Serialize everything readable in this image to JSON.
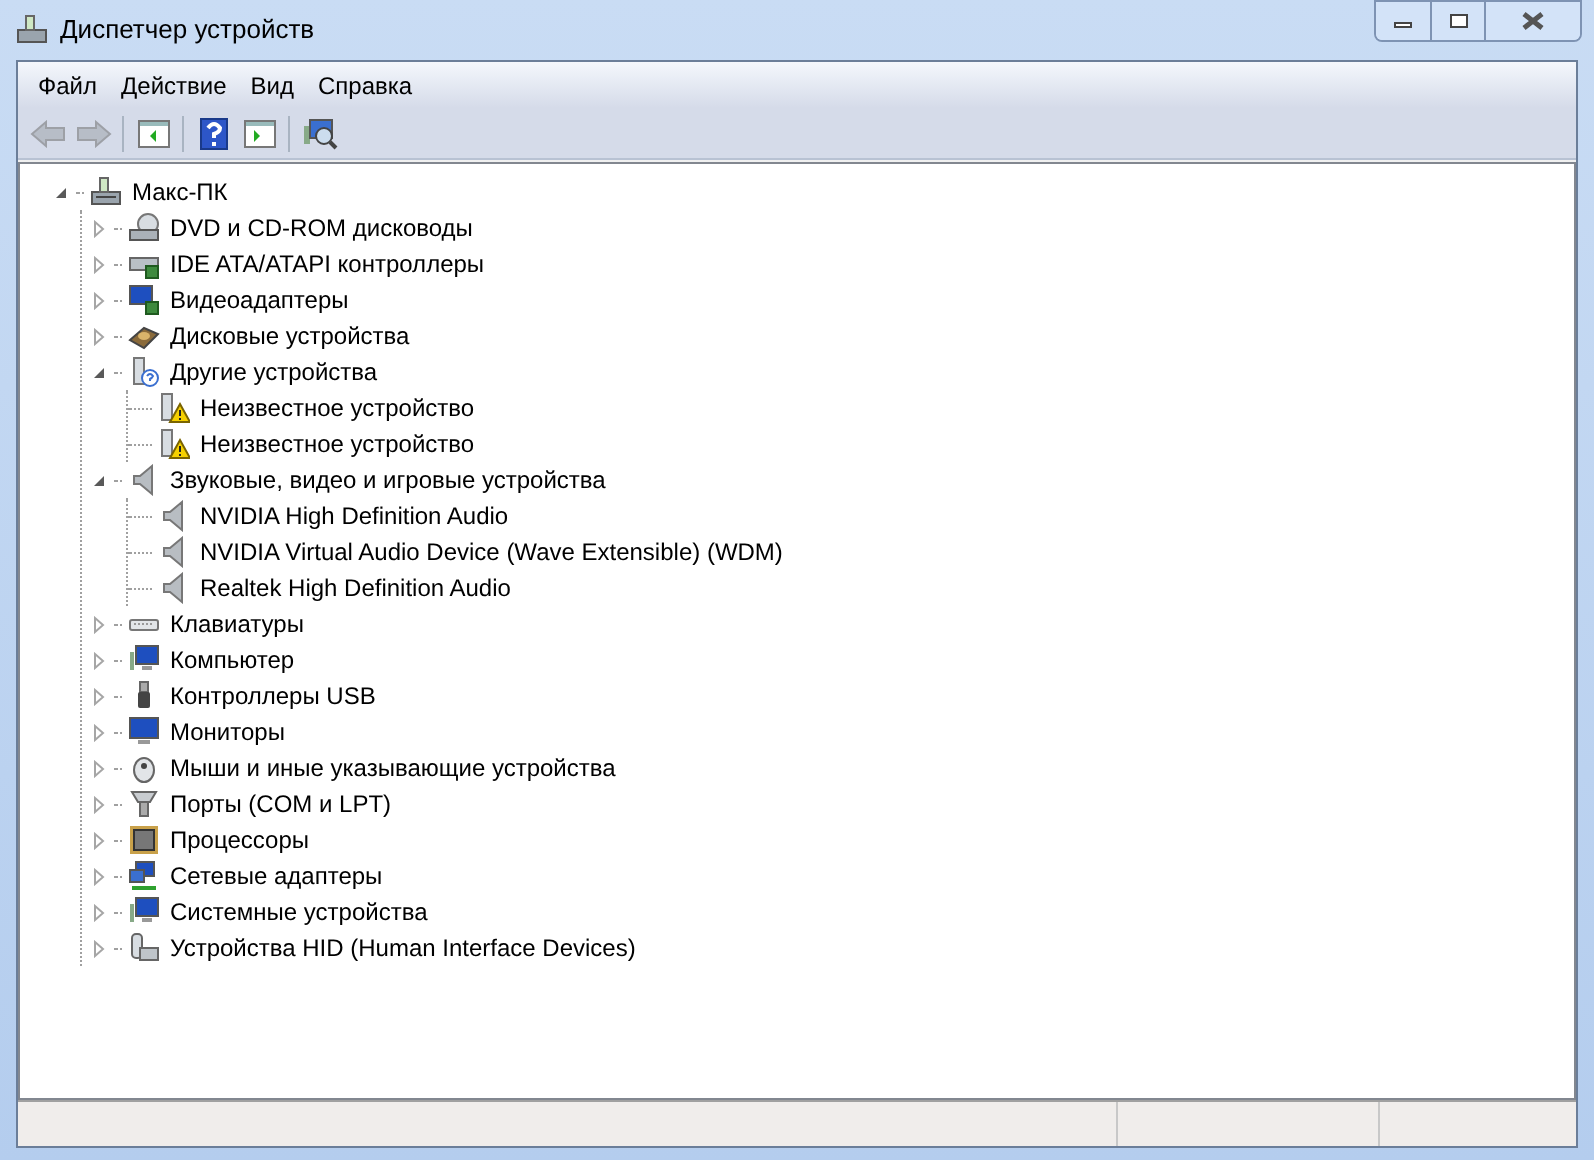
{
  "window": {
    "title": "Диспетчер устройств"
  },
  "menu": [
    "Файл",
    "Действие",
    "Вид",
    "Справка"
  ],
  "toolbar": [
    {
      "kind": "back",
      "disabled": true
    },
    {
      "kind": "forward",
      "disabled": true
    },
    {
      "kind": "sep"
    },
    {
      "kind": "console",
      "disabled": false
    },
    {
      "kind": "sep"
    },
    {
      "kind": "help",
      "disabled": false
    },
    {
      "kind": "panel",
      "disabled": false
    },
    {
      "kind": "sep"
    },
    {
      "kind": "scan",
      "disabled": false
    }
  ],
  "tree": {
    "label": "Макс-ПК",
    "kind": "computer",
    "expanded": true,
    "children": [
      {
        "label": "DVD и CD-ROM дисководы",
        "kind": "dvd",
        "expanded": false
      },
      {
        "label": "IDE ATA/ATAPI контроллеры",
        "kind": "ide",
        "expanded": false
      },
      {
        "label": "Видеоадаптеры",
        "kind": "display",
        "expanded": false
      },
      {
        "label": "Дисковые устройства",
        "kind": "disk",
        "expanded": false
      },
      {
        "label": "Другие устройства",
        "kind": "other",
        "expanded": true,
        "children": [
          {
            "label": "Неизвестное устройство",
            "kind": "unknown"
          },
          {
            "label": "Неизвестное устройство",
            "kind": "unknown"
          }
        ]
      },
      {
        "label": "Звуковые, видео и игровые устройства",
        "kind": "sound",
        "expanded": true,
        "children": [
          {
            "label": "NVIDIA High Definition Audio",
            "kind": "sound"
          },
          {
            "label": "NVIDIA Virtual Audio Device (Wave Extensible) (WDM)",
            "kind": "sound"
          },
          {
            "label": "Realtek High Definition Audio",
            "kind": "sound"
          }
        ]
      },
      {
        "label": "Клавиатуры",
        "kind": "keyboard",
        "expanded": false
      },
      {
        "label": "Компьютер",
        "kind": "system",
        "expanded": false
      },
      {
        "label": "Контроллеры USB",
        "kind": "usb",
        "expanded": false
      },
      {
        "label": "Мониторы",
        "kind": "monitor",
        "expanded": false
      },
      {
        "label": "Мыши и иные указывающие устройства",
        "kind": "mouse",
        "expanded": false
      },
      {
        "label": "Порты (COM и LPT)",
        "kind": "port",
        "expanded": false
      },
      {
        "label": "Процессоры",
        "kind": "cpu",
        "expanded": false
      },
      {
        "label": "Сетевые адаптеры",
        "kind": "network",
        "expanded": false
      },
      {
        "label": "Системные устройства",
        "kind": "system",
        "expanded": false
      },
      {
        "label": "Устройства HID (Human Interface Devices)",
        "kind": "hid",
        "expanded": false
      }
    ]
  }
}
